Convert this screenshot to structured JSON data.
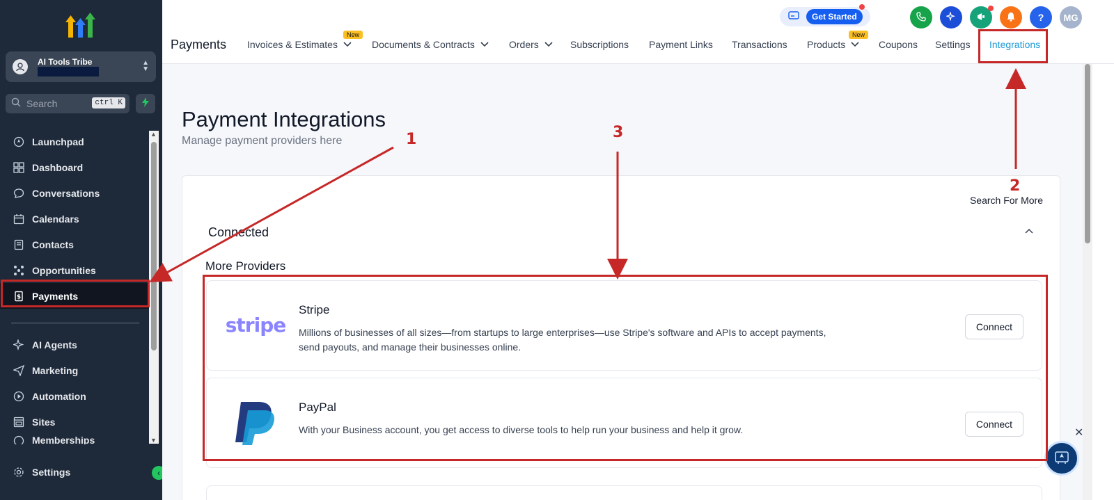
{
  "sidebar": {
    "account_name": "AI Tools Tribe",
    "search_placeholder": "Search",
    "search_shortcut": "ctrl K",
    "items": [
      {
        "label": "Launchpad",
        "icon": "rocket-icon"
      },
      {
        "label": "Dashboard",
        "icon": "grid-icon"
      },
      {
        "label": "Conversations",
        "icon": "chat-icon"
      },
      {
        "label": "Calendars",
        "icon": "calendar-icon"
      },
      {
        "label": "Contacts",
        "icon": "contacts-icon"
      },
      {
        "label": "Opportunities",
        "icon": "opportunities-icon"
      },
      {
        "label": "Payments",
        "icon": "payments-icon",
        "active": true
      },
      {
        "label": "AI Agents",
        "icon": "sparkle-icon"
      },
      {
        "label": "Marketing",
        "icon": "send-icon"
      },
      {
        "label": "Automation",
        "icon": "play-icon"
      },
      {
        "label": "Sites",
        "icon": "sites-icon"
      },
      {
        "label": "Memberships",
        "icon": "membership-icon"
      }
    ],
    "settings_label": "Settings"
  },
  "header": {
    "get_started": "Get Started",
    "avatar_initials": "MG",
    "help": "?",
    "page_title": "Payments",
    "new_badge": "New",
    "tabs": [
      {
        "label": "Invoices & Estimates",
        "dropdown": true,
        "badge": true
      },
      {
        "label": "Documents & Contracts",
        "dropdown": true
      },
      {
        "label": "Orders",
        "dropdown": true
      },
      {
        "label": "Subscriptions"
      },
      {
        "label": "Payment Links"
      },
      {
        "label": "Transactions"
      },
      {
        "label": "Products",
        "dropdown": true,
        "badge": true
      },
      {
        "label": "Coupons"
      },
      {
        "label": "Settings"
      },
      {
        "label": "Integrations",
        "active": true
      }
    ]
  },
  "main": {
    "title": "Payment Integrations",
    "subtitle": "Manage payment providers here",
    "search_more": "Search For More",
    "connected_label": "Connected",
    "more_providers_label": "More Providers",
    "providers": [
      {
        "name": "Stripe",
        "logo_text": "stripe",
        "description": "Millions of businesses of all sizes—from startups to large enterprises—use Stripe's software and APIs to accept payments, send payouts, and manage their businesses online.",
        "button": "Connect"
      },
      {
        "name": "PayPal",
        "description": "With your Business account, you get access to diverse tools to help run your business and help it grow.",
        "button": "Connect"
      }
    ]
  },
  "annotations": {
    "one": "1",
    "two": "2",
    "three": "3",
    "color": "#c62828"
  },
  "colors": {
    "sidebar_bg": "#1e2a3a",
    "accent": "#1e9ad6",
    "stripe": "#635bff",
    "paypal_dark": "#253b80",
    "paypal_light": "#179bd7"
  }
}
